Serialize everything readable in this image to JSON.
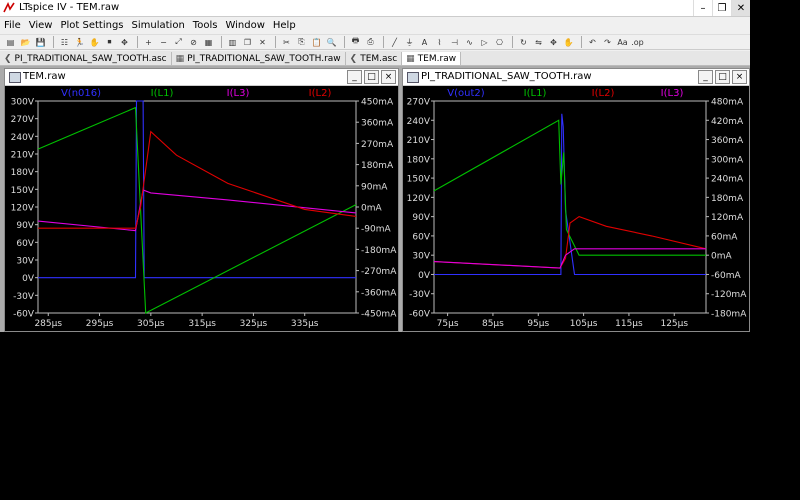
{
  "window": {
    "title": "LTspice IV - TEM.raw"
  },
  "menu": [
    "File",
    "View",
    "Plot Settings",
    "Simulation",
    "Tools",
    "Window",
    "Help"
  ],
  "toolbar_icons": [
    "open-icon",
    "open-folder-icon",
    "save-icon",
    "control-panel-icon",
    "run-icon",
    "pause-icon",
    "halt-icon",
    "pan-icon",
    "zoom-in-icon",
    "zoom-out-icon",
    "zoom-fit-icon",
    "zoom-cancel-icon",
    "autorange-icon",
    "tile-icon",
    "cascade-icon",
    "close-all-icon",
    "cut-icon",
    "copy-icon",
    "paste-icon",
    "find-icon",
    "print-icon",
    "print-preview-icon",
    "draw-line-icon",
    "ground-icon",
    "label-icon",
    "resistor-icon",
    "capacitor-icon",
    "inductor-icon",
    "diode-icon",
    "component-icon",
    "rotate-icon",
    "mirror-icon",
    "move-icon",
    "drag-icon",
    "undo-icon",
    "redo-icon",
    "text-icon",
    "spice-directive-icon"
  ],
  "tabs": [
    {
      "label": "PI_TRADITIONAL_SAW_TOOTH.asc",
      "icon": "schematic-icon",
      "active": false
    },
    {
      "label": "PI_TRADITIONAL_SAW_TOOTH.raw",
      "icon": "waveform-icon",
      "active": false
    },
    {
      "label": "TEM.asc",
      "icon": "schematic-icon",
      "active": false
    },
    {
      "label": "TEM.raw",
      "icon": "waveform-icon",
      "active": true
    }
  ],
  "plots": [
    {
      "title": "TEM.raw",
      "buttons": [
        "_",
        "□",
        "×"
      ],
      "traces": [
        {
          "label": "V(n016)",
          "color": "#3030ff"
        },
        {
          "label": "I(L1)",
          "color": "#00c000"
        },
        {
          "label": "I(L3)",
          "color": "#e000e0"
        },
        {
          "label": "I(L2)",
          "color": "#e00000"
        }
      ],
      "left_ticks": [
        "300V",
        "270V",
        "240V",
        "210V",
        "180V",
        "150V",
        "120V",
        "90V",
        "60V",
        "30V",
        "0V",
        "-30V",
        "-60V"
      ],
      "right_ticks": [
        "450mA",
        "360mA",
        "270mA",
        "180mA",
        "90mA",
        "0mA",
        "-90mA",
        "-180mA",
        "-270mA",
        "-360mA",
        "-450mA"
      ],
      "x_ticks": [
        "285µs",
        "295µs",
        "305µs",
        "315µs",
        "325µs",
        "335µs"
      ],
      "chart_data": {
        "type": "line",
        "x_range_us": [
          283,
          345
        ],
        "y_left_range_V": [
          -60,
          300
        ],
        "y_right_range_mA": [
          -450,
          450
        ],
        "series": [
          {
            "name": "V(n016)",
            "axis": "left",
            "x": [
              283,
              302,
              302.2,
              303.5,
              303.7,
              345
            ],
            "y": [
              0,
              0,
              300,
              300,
              0,
              0
            ]
          },
          {
            "name": "I(L1)",
            "axis": "right",
            "x": [
              283,
              302,
              304,
              345
            ],
            "y": [
              246,
              422,
              -450,
              10
            ]
          },
          {
            "name": "I(L3)",
            "axis": "right",
            "x": [
              283,
              302,
              303.5,
              305,
              320,
              345
            ],
            "y": [
              -60,
              -100,
              72,
              60,
              30,
              -25
            ]
          },
          {
            "name": "I(L2)",
            "axis": "right",
            "x": [
              283,
              302,
              303,
              305,
              310,
              320,
              335,
              345
            ],
            "y": [
              -90,
              -90,
              0,
              320,
              220,
              100,
              -10,
              -40
            ]
          }
        ]
      }
    },
    {
      "title": "PI_TRADITIONAL_SAW_TOOTH.raw",
      "buttons": [
        "_",
        "□",
        "×"
      ],
      "traces": [
        {
          "label": "V(out2)",
          "color": "#3030ff"
        },
        {
          "label": "I(L1)",
          "color": "#00c000"
        },
        {
          "label": "I(L2)",
          "color": "#e00000"
        },
        {
          "label": "I(L3)",
          "color": "#e000e0"
        }
      ],
      "left_ticks": [
        "270V",
        "240V",
        "210V",
        "180V",
        "150V",
        "120V",
        "90V",
        "60V",
        "30V",
        "0V",
        "-30V",
        "-60V"
      ],
      "right_ticks": [
        "480mA",
        "420mA",
        "360mA",
        "300mA",
        "240mA",
        "180mA",
        "120mA",
        "60mA",
        "0mA",
        "-60mA",
        "-120mA",
        "-180mA"
      ],
      "x_ticks": [
        "75µs",
        "85µs",
        "95µs",
        "105µs",
        "115µs",
        "125µs"
      ],
      "chart_data": {
        "type": "line",
        "x_range_us": [
          72,
          132
        ],
        "y_left_range_V": [
          -60,
          270
        ],
        "y_right_range_mA": [
          -180,
          480
        ],
        "series": [
          {
            "name": "V(out2)",
            "axis": "left",
            "x": [
              72,
              100,
              100.2,
              100.5,
              101,
              103,
              132
            ],
            "y": [
              0,
              0,
              250,
              230,
              100,
              0,
              0
            ]
          },
          {
            "name": "I(L1)",
            "axis": "right",
            "x": [
              72,
              99.5,
              100,
              100.6,
              101.2,
              104,
              132
            ],
            "y": [
              200,
              420,
              220,
              320,
              80,
              0,
              0
            ]
          },
          {
            "name": "I(L2)",
            "axis": "right",
            "x": [
              72,
              99.8,
              101,
              102,
              104,
              110,
              120,
              132
            ],
            "y": [
              -20,
              -40,
              -10,
              100,
              120,
              90,
              60,
              20
            ]
          },
          {
            "name": "I(L3)",
            "axis": "right",
            "x": [
              72,
              99.8,
              101,
              103,
              132
            ],
            "y": [
              -20,
              -40,
              0,
              20,
              20
            ]
          }
        ]
      }
    }
  ]
}
